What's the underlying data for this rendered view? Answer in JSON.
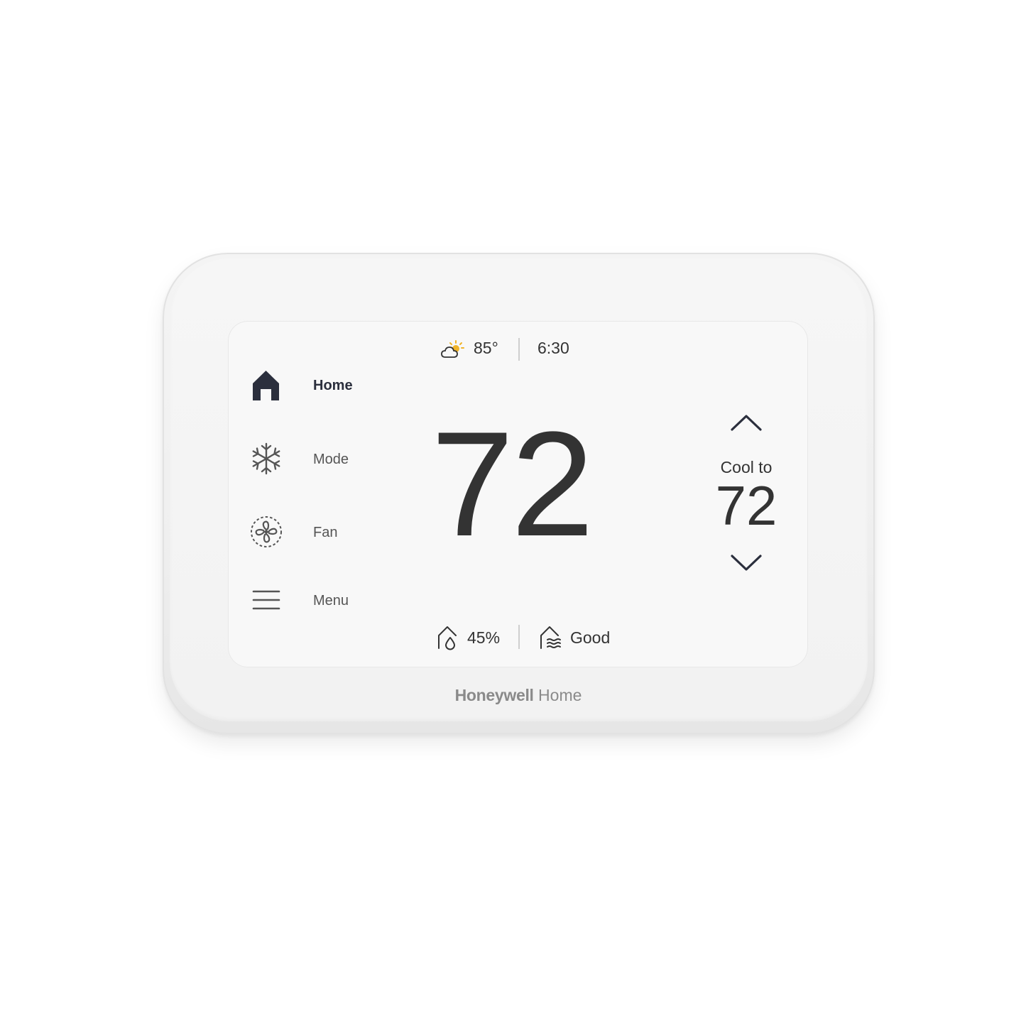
{
  "device": {
    "brand_primary": "Honeywell",
    "brand_secondary": "Home"
  },
  "status_bar": {
    "weather_icon": "partly-sunny-icon",
    "outdoor_temperature": "85°",
    "time": "6:30"
  },
  "sidebar": {
    "items": [
      {
        "label": "Home",
        "icon": "home-icon",
        "active": true
      },
      {
        "label": "Mode",
        "icon": "snowflake-icon",
        "active": false
      },
      {
        "label": "Fan",
        "icon": "fan-icon",
        "active": false
      },
      {
        "label": "Menu",
        "icon": "hamburger-menu-icon",
        "active": false
      }
    ]
  },
  "main": {
    "current_temperature": "72"
  },
  "setpoint": {
    "label": "Cool to",
    "value": "72",
    "up_icon": "chevron-up-icon",
    "down_icon": "chevron-down-icon"
  },
  "bottom_bar": {
    "humidity_icon": "indoor-humidity-icon",
    "humidity": "45%",
    "air_quality_icon": "indoor-air-quality-icon",
    "air_quality": "Good"
  },
  "colors": {
    "accent_active": "#2b2f3d",
    "text_primary": "#333333",
    "text_secondary": "#555555",
    "sun": "#f0b429",
    "brand_gray": "#8a8a8a"
  }
}
